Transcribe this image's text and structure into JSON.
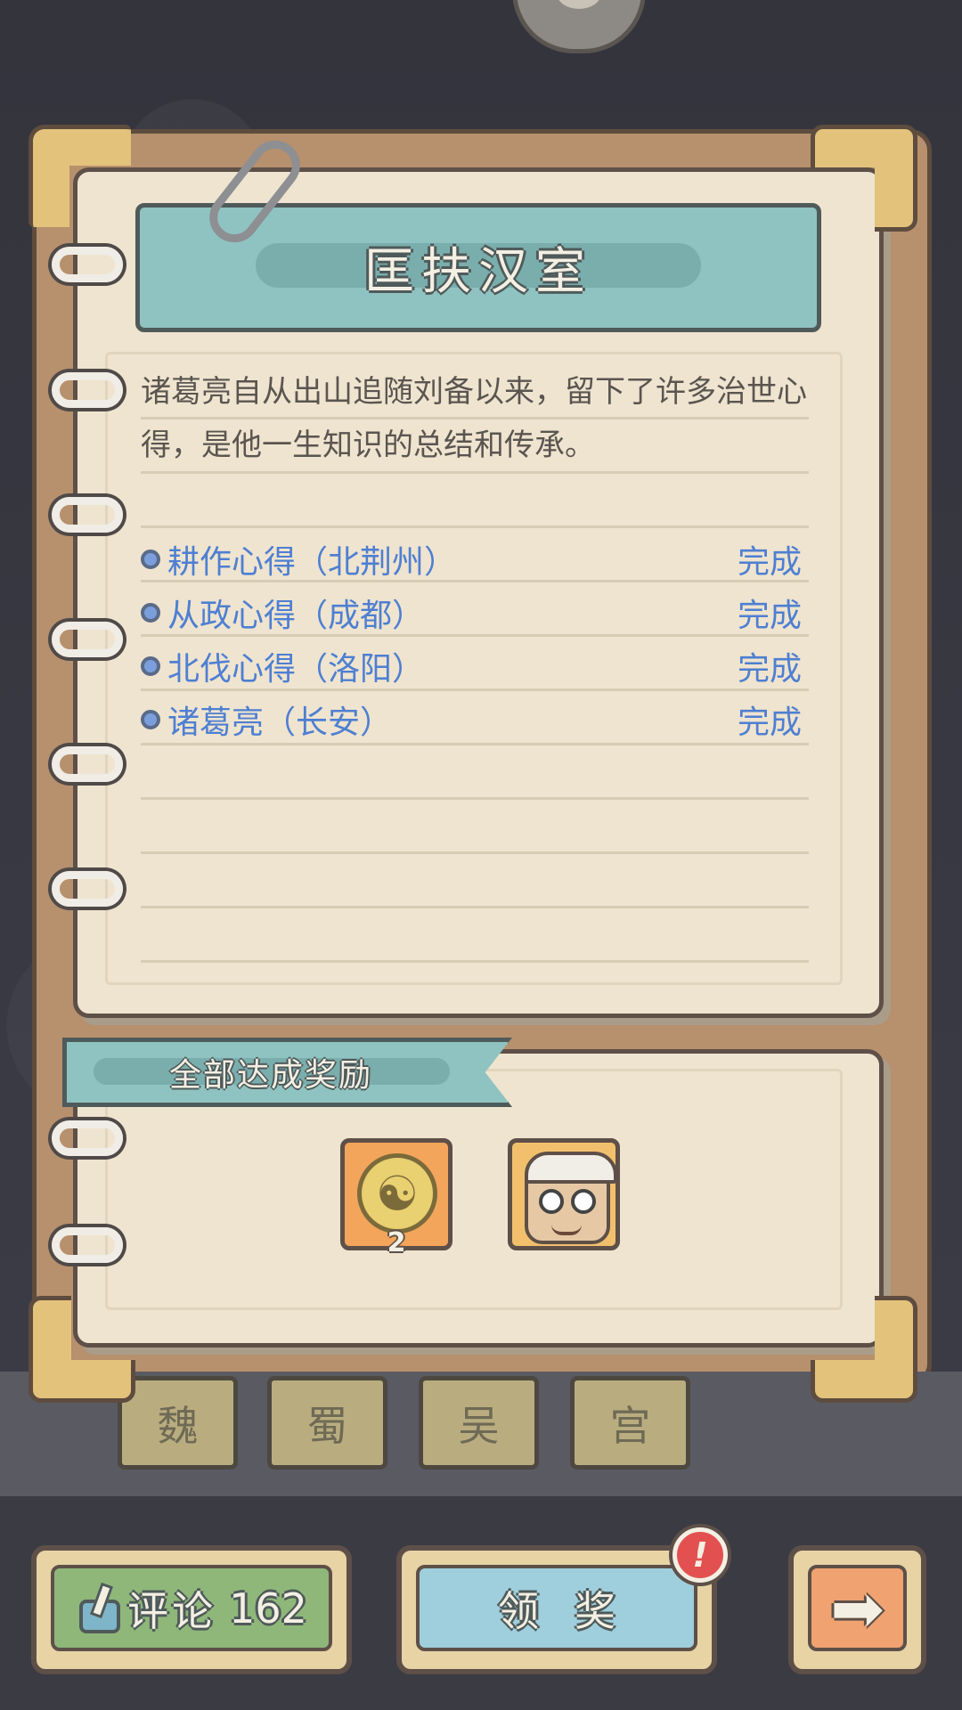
{
  "book": {
    "title": "匡扶汉室",
    "description": "诸葛亮自从出山追随刘备以来，留下了许多治世心得，是他一生知识的总结和传承。",
    "tasks": [
      {
        "name": "耕作心得（北荆州）",
        "status": "完成"
      },
      {
        "name": "从政心得（成都）",
        "status": "完成"
      },
      {
        "name": "北伐心得（洛阳）",
        "status": "完成"
      },
      {
        "name": "诸葛亮（长安）",
        "status": "完成"
      }
    ]
  },
  "reward": {
    "title": "全部达成奖励",
    "items": [
      {
        "icon": "yin-yang-coin-icon",
        "count": "2"
      },
      {
        "icon": "character-portrait-icon",
        "count": ""
      }
    ]
  },
  "shelf": {
    "boxes": [
      "魏",
      "蜀",
      "吴",
      "宫"
    ]
  },
  "buttons": {
    "comment_label": "评论",
    "comment_count": "162",
    "claim_label": "领奖",
    "alert_mark": "!",
    "next_icon": "arrow-right-icon"
  },
  "colors": {
    "task_blue": "#4e7fd2",
    "banner_teal": "#8fc3c1",
    "comment_green": "#8fb77a",
    "claim_blue": "#9fcfdd",
    "next_orange": "#f0a370",
    "alert_red": "#e35050"
  }
}
